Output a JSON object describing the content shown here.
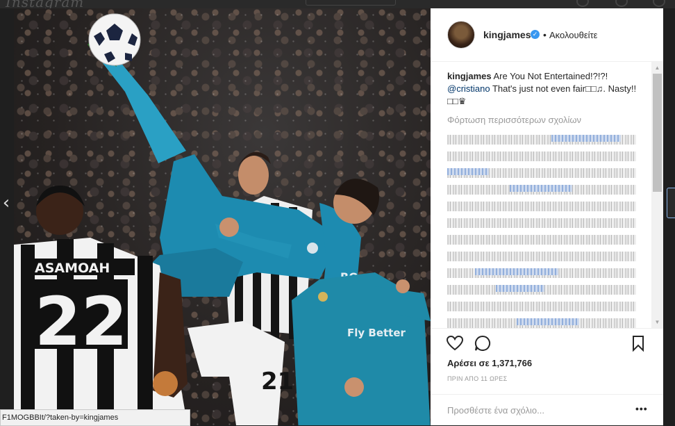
{
  "topbar": {
    "logo": "Instagram"
  },
  "post": {
    "username": "kingjames",
    "verified_glyph": "✓",
    "separator": "•",
    "follow_label": "Ακολουθείτε",
    "caption_user": "kingjames",
    "caption_text_1": " Are You Not Entertained!?!?! ",
    "caption_mention": "@cristiano",
    "caption_text_2": " That's just not even fair□□♫. Nasty!! □□♛",
    "load_more_label": "Φόρτωση περισσότερων σχολίων",
    "likes_label": "Αρέσει σε 1,371,766",
    "time_label": "ΠΡΙΝ ΑΠΟ 11 ΩΡΕΣ",
    "comment_placeholder": "Προσθέστε ένα σχόλιο...",
    "more_label": "•••"
  },
  "photo": {
    "shirt_name": "ASAMOAH",
    "shirt_number": "22",
    "shirt_number_2": "21",
    "shirt_text_3": "RO",
    "sponsor_text": "Fly Better"
  },
  "status_bar": {
    "url": "F1MOGBBIt/?taken-by=kingjames"
  },
  "icons": {
    "nav_left": "‹",
    "scroll_up": "▲",
    "scroll_down": "▼"
  },
  "colors": {
    "accent_blue": "#3897f0",
    "mention_blue": "#003569",
    "real_madrid_teal": "#1f8aa8"
  }
}
